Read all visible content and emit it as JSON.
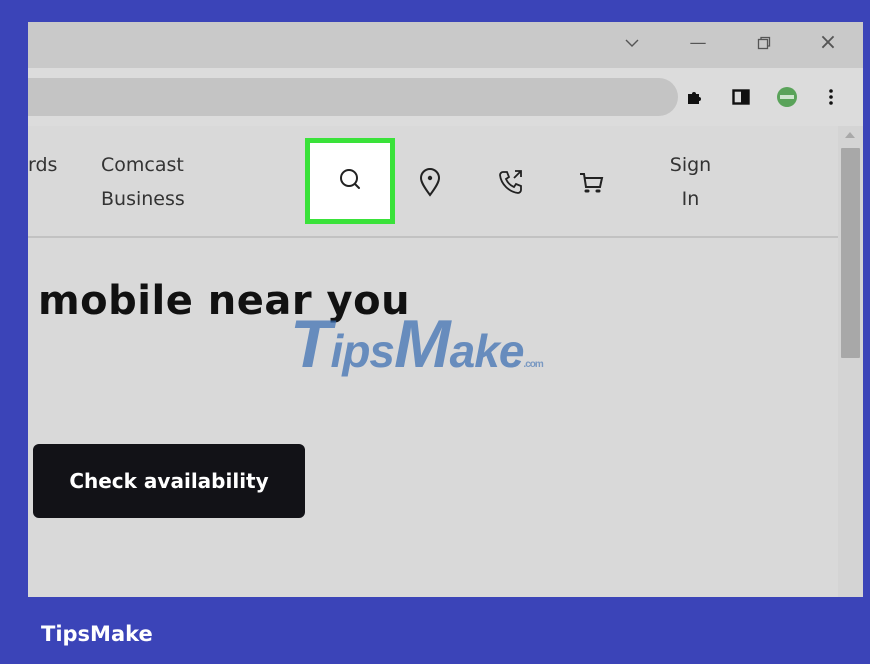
{
  "window": {
    "controls": {
      "dropdown_icon": "chevron-down-icon",
      "minimize": "—",
      "restore": "restore-icon",
      "close": "×"
    }
  },
  "toolbar": {
    "icons": [
      "puzzle-extensions-icon",
      "side-panel-icon",
      "profile-avatar-icon",
      "kebab-menu-icon"
    ]
  },
  "nav": {
    "partial_item": "rds",
    "business_line1": "Comcast",
    "business_line2": "Business",
    "icons": [
      "search-icon",
      "location-pin-icon",
      "phone-icon",
      "cart-icon"
    ],
    "signin_line1": "Sign",
    "signin_line2": "In"
  },
  "main": {
    "headline": "mobile near you",
    "cta_label": "Check availability"
  },
  "watermark": {
    "T": "T",
    "ips": "ips",
    "M": "M",
    "ake": "ake",
    "com": ".com"
  },
  "footer": {
    "brand": "TipsMake"
  },
  "colors": {
    "frame_background": "#3b44b8",
    "highlight": "#3ae23a",
    "cta_background": "#121217",
    "watermark": "#3a6eb2"
  }
}
